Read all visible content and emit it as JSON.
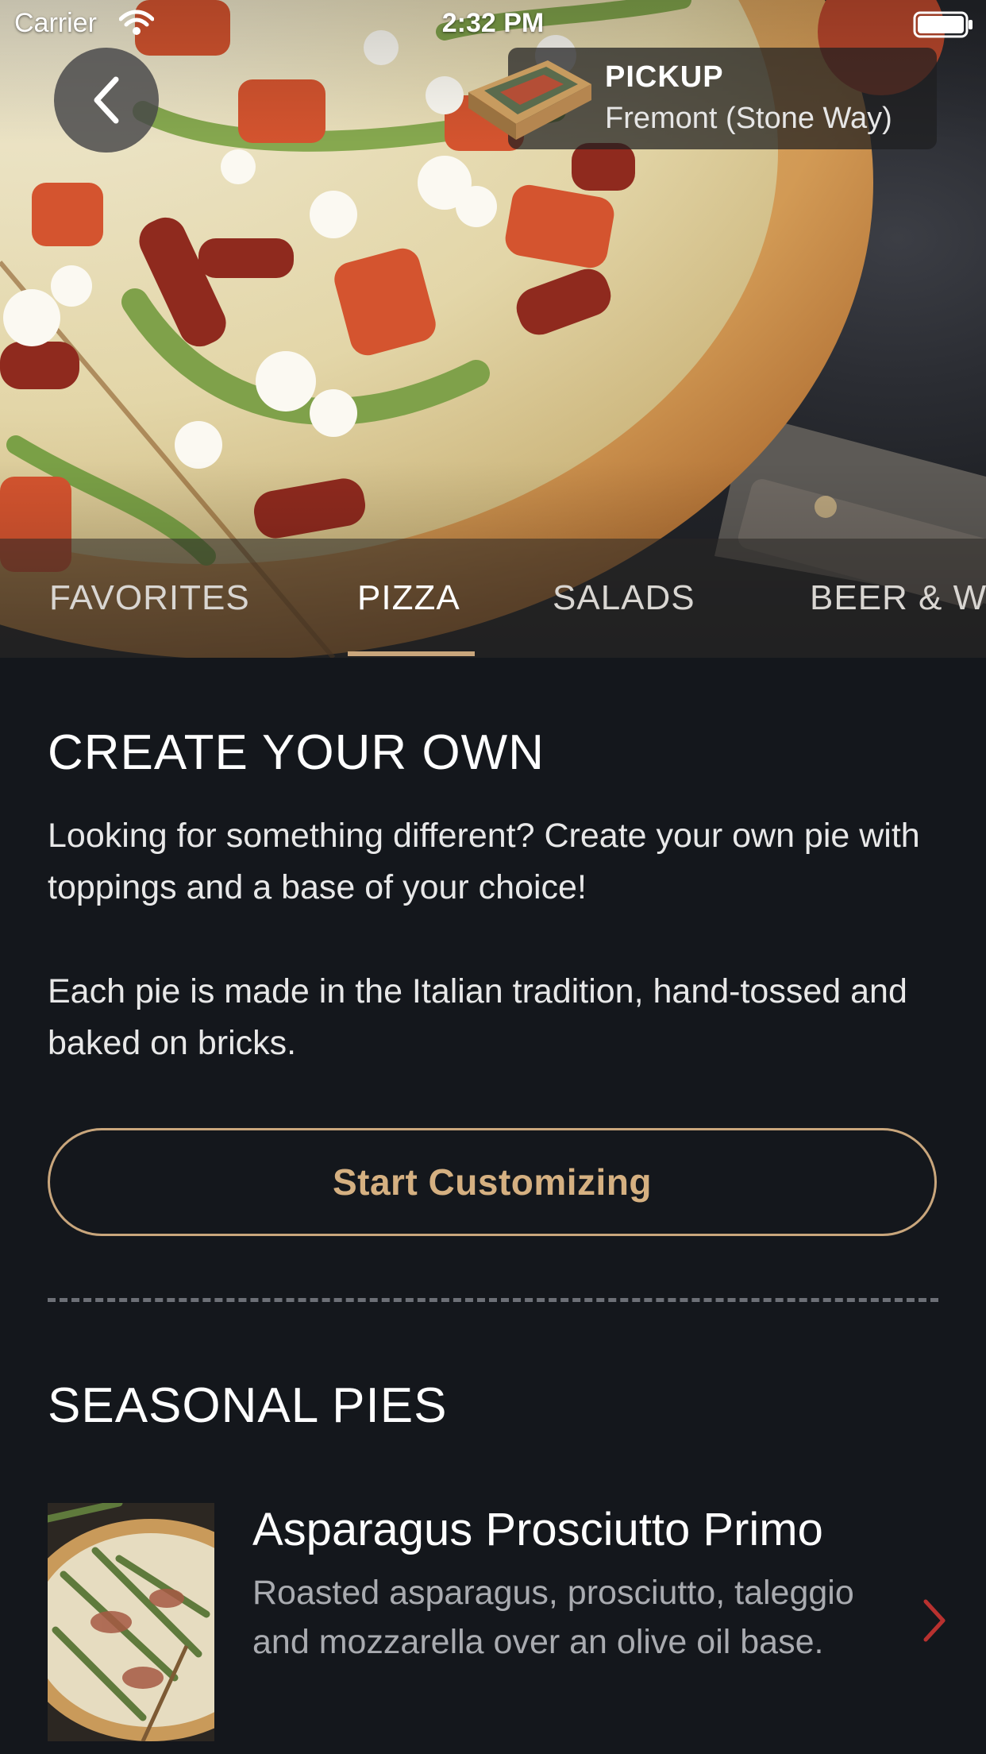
{
  "status_bar": {
    "carrier": "Carrier",
    "time": "2:32 PM"
  },
  "header": {
    "back_icon": "chevron-left-icon",
    "pickup_label": "PICKUP",
    "pickup_location": "Fremont (Stone Way)",
    "pickup_icon": "pizza-box-icon"
  },
  "tabs": [
    {
      "label": "FAVORITES",
      "active": false
    },
    {
      "label": "PIZZA",
      "active": true
    },
    {
      "label": "SALADS",
      "active": false
    },
    {
      "label": "BEER & WINE",
      "active": false
    }
  ],
  "create_your_own": {
    "title": "CREATE YOUR OWN",
    "paragraph_1": "Looking for something different? Create your own pie with toppings and a base of your choice!",
    "paragraph_2": "Each pie is made in the Italian tradition, hand-tossed and baked on bricks.",
    "button_label": "Start Customizing"
  },
  "seasonal": {
    "title": "SEASONAL PIES",
    "items": [
      {
        "name": "Asparagus Prosciutto Primo",
        "description": "Roasted asparagus, prosciutto, taleggio and mozzarella over an olive oil base.",
        "chevron_icon": "chevron-right-icon"
      }
    ]
  },
  "colors": {
    "background": "#14171c",
    "accent": "#c9a67c",
    "chevron": "#b8312f",
    "muted_text": "#a9abb0"
  }
}
